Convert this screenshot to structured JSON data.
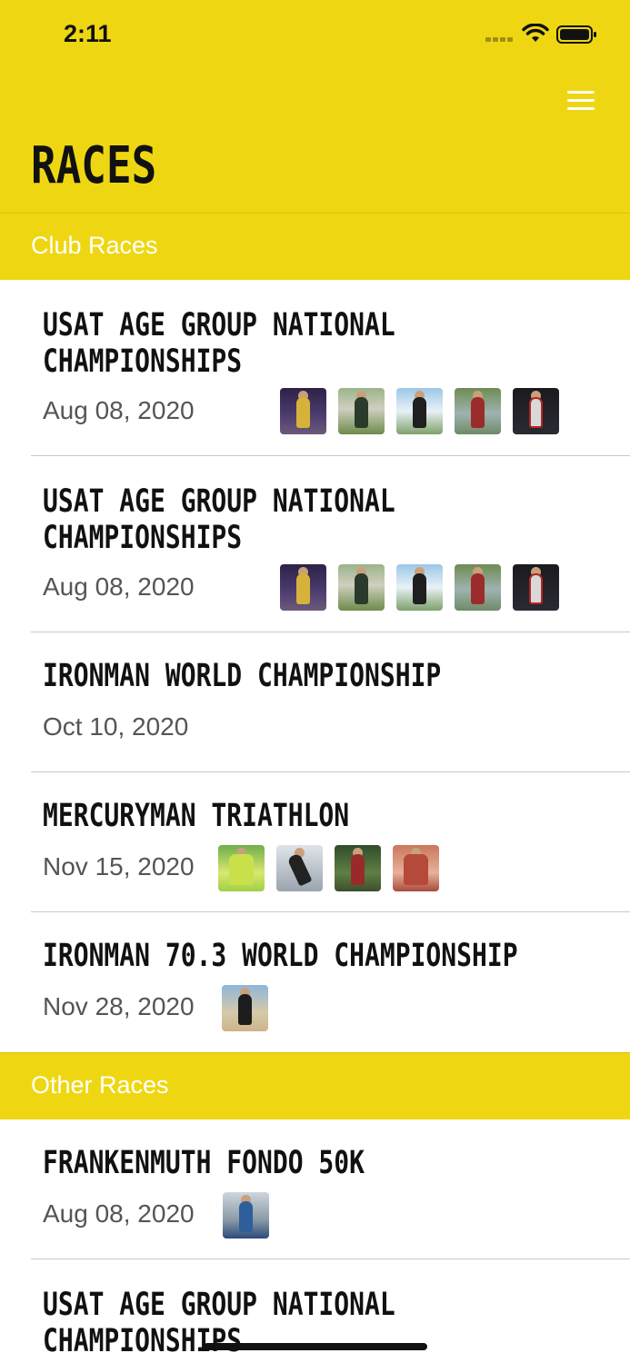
{
  "status_bar": {
    "time": "2:11"
  },
  "header": {
    "title": "RACES",
    "menu_icon": "hamburger-menu-icon",
    "background": "#EED712"
  },
  "sections": [
    {
      "title": "Club Races",
      "races": [
        {
          "name": "USAT AGE GROUP NATIONAL CHAMPIONSHIPS",
          "date": "Aug 08, 2020",
          "photos": [
            "night-runner",
            "finish-line",
            "cyclist",
            "pond-runner",
            "race-kit"
          ]
        },
        {
          "name": "USAT AGE GROUP NATIONAL CHAMPIONSHIPS",
          "date": "Aug 08, 2020",
          "photos": [
            "night-runner",
            "finish-line",
            "cyclist",
            "pond-runner",
            "race-kit"
          ]
        },
        {
          "name": "IRONMAN WORLD CHAMPIONSHIP",
          "date": "Oct 10, 2020",
          "photos": []
        },
        {
          "name": "MERCURYMAN TRIATHLON",
          "date": "Nov 15, 2020",
          "photos": [
            "selfie",
            "cyclist-road",
            "trail-rider",
            "portrait"
          ]
        },
        {
          "name": "IRONMAN 70.3 WORLD CHAMPIONSHIP",
          "date": "Nov 28, 2020",
          "photos": [
            "beach"
          ]
        }
      ]
    },
    {
      "title": "Other Races",
      "races": [
        {
          "name": "FRANKENMUTH FONDO 50K",
          "date": "Aug 08, 2020",
          "photos": [
            "bike-shop"
          ]
        },
        {
          "name": "USAT AGE GROUP NATIONAL CHAMPIONSHIPS",
          "date": "",
          "photos": []
        }
      ]
    }
  ]
}
